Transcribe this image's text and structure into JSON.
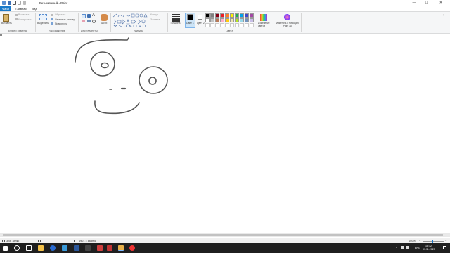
{
  "window": {
    "title": "Безымянный - Paint",
    "minimize": "—",
    "maximize": "☐",
    "close": "✕"
  },
  "tabs": [
    "Файл",
    "Главная",
    "Вид"
  ],
  "ribbon": {
    "clipboard": {
      "paste": "Вставить",
      "cut": "Вырезать",
      "copy": "Копировать",
      "label": "Буфер обмена"
    },
    "image": {
      "select": "Выделить",
      "crop": "Обрезать",
      "resize": "Изменить размер",
      "rotate": "Повернуть",
      "label": "Изображение"
    },
    "tools": {
      "brushes": "Кисти",
      "label": "Инструменты"
    },
    "shapes": {
      "outline": "Контур",
      "fill": "Заливка",
      "label": "Фигуры"
    },
    "size": {
      "label": "Толщина"
    },
    "color1": {
      "label": "Цвет 1"
    },
    "color2": {
      "label": "Цвет 2"
    },
    "edit_colors": "Изменение цветов",
    "paint3d": "Изменить с помощью Paint 3D",
    "colors_label": "Цвета",
    "palette_row1": [
      "#000000",
      "#7f7f7f",
      "#880015",
      "#ed1c24",
      "#ff7f27",
      "#fff200",
      "#22b14c",
      "#00a2e8",
      "#3f48cc",
      "#a349a4"
    ],
    "palette_row2": [
      "#ffffff",
      "#c3c3c3",
      "#b97a57",
      "#ffaec9",
      "#ffc90e",
      "#efe4b0",
      "#b5e61d",
      "#99d9ea",
      "#7092be",
      "#c8bfe7"
    ]
  },
  "status": {
    "cursor_pos": "328, 34пкс",
    "canvas_size": "1901 × 868пкс",
    "zoom": "100%"
  },
  "taskbar": {
    "lang": "ENG",
    "time": "13:12",
    "date": "01.11.2023"
  }
}
